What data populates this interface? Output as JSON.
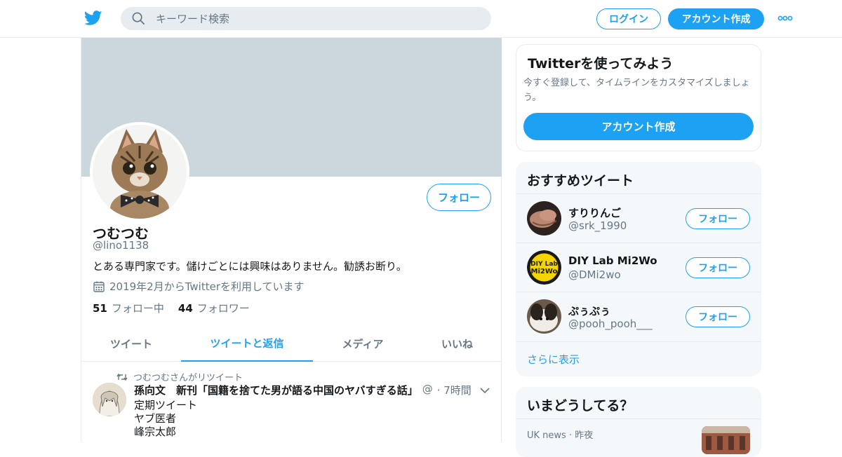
{
  "header": {
    "search_placeholder": "キーワード検索",
    "login_label": "ログイン",
    "signup_label": "アカウント作成"
  },
  "profile": {
    "display_name": "つむつむ",
    "handle": "@lino1138",
    "follow_label": "フォロー",
    "bio": "とある専門家です。儲けごとには興味はありません。勧誘お断り。",
    "joined": "2019年2月からTwitterを利用しています",
    "following_count": "51",
    "following_label": "フォロー中",
    "followers_count": "44",
    "followers_label": "フォロワー"
  },
  "tabs": [
    {
      "label": "ツイート"
    },
    {
      "label": "ツイートと返信"
    },
    {
      "label": "メディア"
    },
    {
      "label": "いいね"
    }
  ],
  "tweet": {
    "retweet_context": "つむつむさんがリツイート",
    "author_name": "孫向文　新刊「国籍を捨てた男が語る中国のヤバすぎる話」",
    "author_handle": "@",
    "time": "· 7時間",
    "lines": [
      "定期ツイート",
      "ヤブ医者",
      "峰宗太郎"
    ]
  },
  "signup_card": {
    "title": "Twitterを使ってみよう",
    "subtitle": "今すぐ登録して、タイムラインをカスタマイズしましょう。",
    "button_label": "アカウント作成"
  },
  "recommended": {
    "title": "おすすめツイート",
    "items": [
      {
        "name": "すりりんご",
        "handle": "@srk_1990",
        "follow_label": "フォロー"
      },
      {
        "name": "DIY Lab Mi2Wo",
        "handle": "@DMi2wo",
        "follow_label": "フォロー"
      },
      {
        "name": "ぷぅぷぅ",
        "handle": "@pooh_pooh___",
        "follow_label": "フォロー"
      }
    ],
    "show_more": "さらに表示"
  },
  "trends": {
    "title": "いまどうしてる？",
    "items": [
      {
        "meta": "UK news · 昨夜"
      }
    ]
  },
  "colors": {
    "accent": "#1da1f2",
    "banner": "#ccd6dd",
    "muted_text": "#657786",
    "panel_bg": "#f5f8fa"
  },
  "icons": {
    "logo": "twitter-bird-icon",
    "search": "search-icon",
    "more": "more-dots-icon",
    "calendar": "calendar-icon",
    "retweet": "retweet-icon",
    "chevron": "chevron-down-icon"
  }
}
